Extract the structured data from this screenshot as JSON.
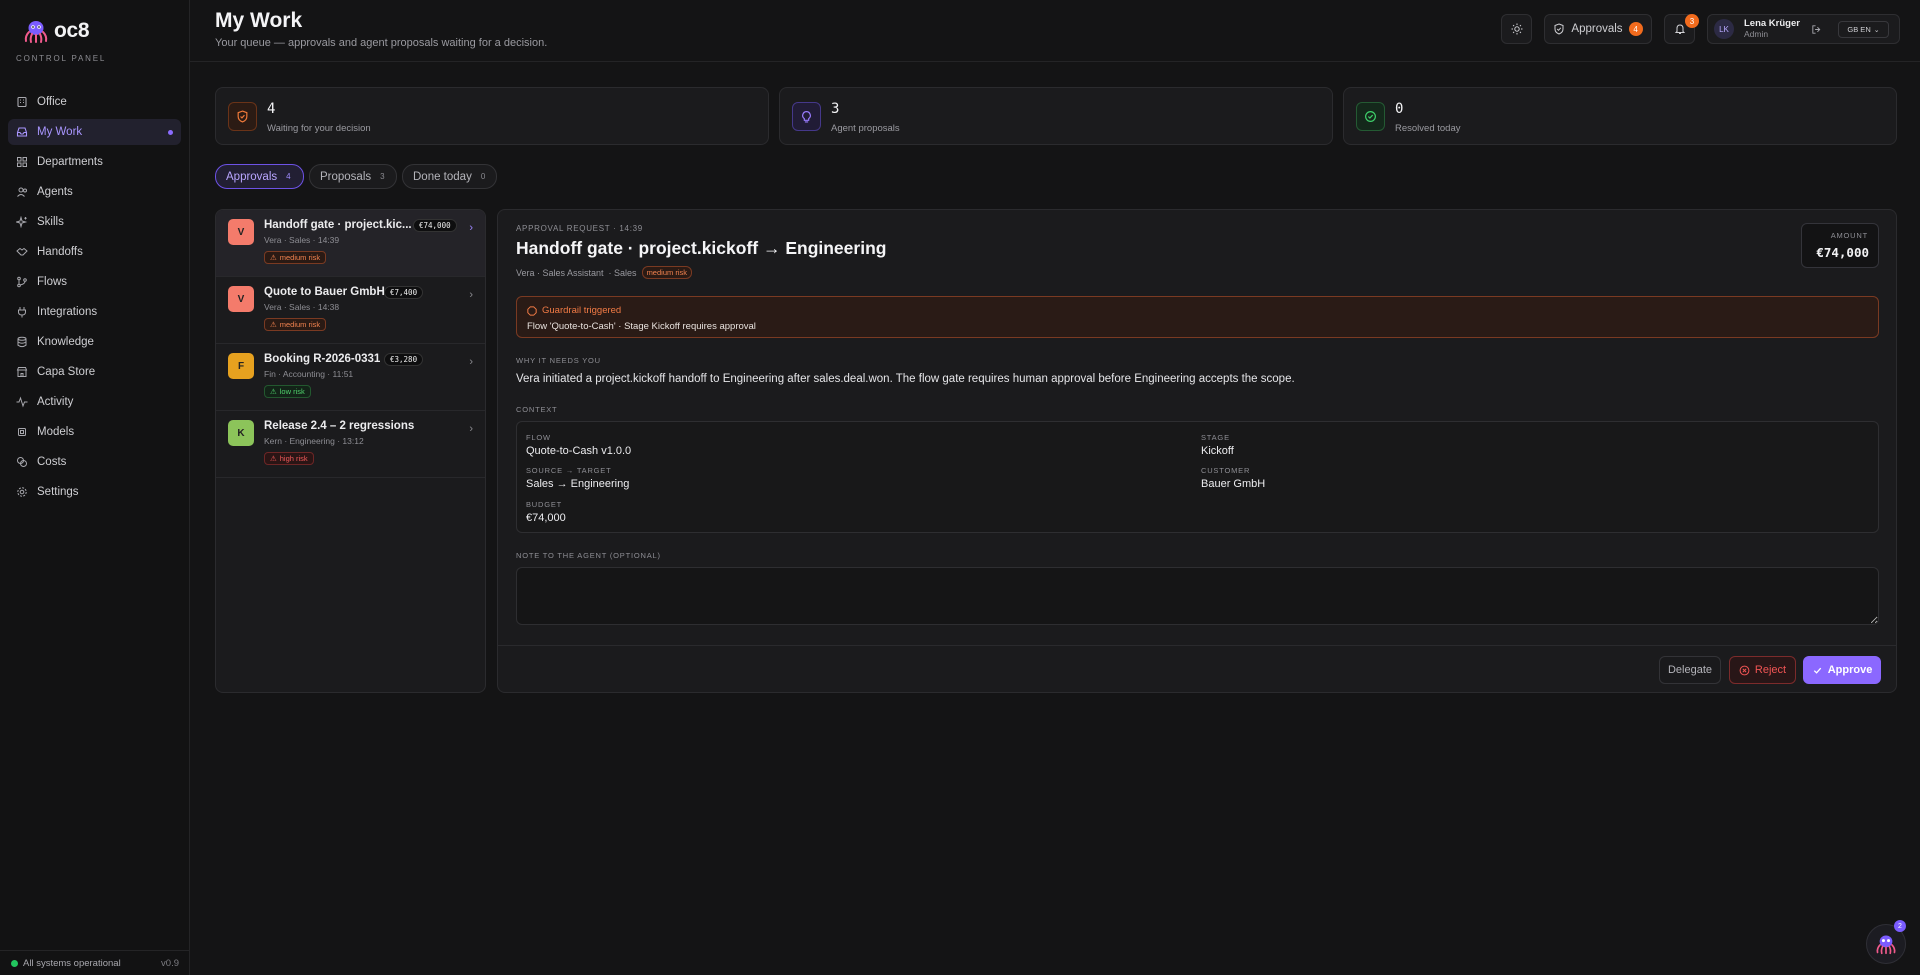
{
  "brand": {
    "name": "oc8",
    "subtitle": "CONTROL PANEL"
  },
  "nav": [
    {
      "label": "Office",
      "icon": "building-icon"
    },
    {
      "label": "My Work",
      "icon": "inbox-icon",
      "active": true
    },
    {
      "label": "Departments",
      "icon": "grid-icon"
    },
    {
      "label": "Agents",
      "icon": "users-icon"
    },
    {
      "label": "Skills",
      "icon": "sparkles-icon"
    },
    {
      "label": "Handoffs",
      "icon": "handshake-icon"
    },
    {
      "label": "Flows",
      "icon": "git-branch-icon"
    },
    {
      "label": "Integrations",
      "icon": "plug-icon"
    },
    {
      "label": "Knowledge",
      "icon": "database-icon"
    },
    {
      "label": "Capa Store",
      "icon": "store-icon"
    },
    {
      "label": "Activity",
      "icon": "activity-icon"
    },
    {
      "label": "Models",
      "icon": "cpu-icon"
    },
    {
      "label": "Costs",
      "icon": "coins-icon"
    },
    {
      "label": "Settings",
      "icon": "gear-icon"
    }
  ],
  "footer": {
    "status": "All systems operational",
    "version": "v0.9"
  },
  "header": {
    "title": "My Work",
    "subtitle": "Your queue — approvals and agent proposals waiting for a decision.",
    "approvals_label": "Approvals",
    "approvals_count": "4",
    "notifications_count": "3",
    "user_initials": "LK",
    "user_name": "Lena Krüger",
    "user_role": "Admin",
    "language": "GB EN"
  },
  "stats": [
    {
      "value": "4",
      "label": "Waiting for your decision",
      "icon": "shield-icon",
      "color": "#f07a3a"
    },
    {
      "value": "3",
      "label": "Agent proposals",
      "icon": "lightbulb-icon",
      "color": "#9a7cff"
    },
    {
      "value": "0",
      "label": "Resolved today",
      "icon": "check-circle-icon",
      "color": "#3ecf6a"
    }
  ],
  "tabs": [
    {
      "label": "Approvals",
      "count": "4",
      "active": true
    },
    {
      "label": "Proposals",
      "count": "3"
    },
    {
      "label": "Done today",
      "count": "0"
    }
  ],
  "queue": [
    {
      "initial": "V",
      "color": "#f47b6b",
      "title": "Handoff gate · project.kic...",
      "amount": "€74,000",
      "meta": "Vera · Sales · 14:39",
      "risk": "medium risk",
      "risk_level": "medium",
      "selected": true
    },
    {
      "initial": "V",
      "color": "#f47b6b",
      "title": "Quote to Bauer GmbH",
      "amount": "€7,400",
      "meta": "Vera · Sales · 14:38",
      "risk": "medium risk",
      "risk_level": "medium"
    },
    {
      "initial": "F",
      "color": "#e6a11f",
      "title": "Booking R-2026-0331",
      "amount": "€3,280",
      "meta": "Fin · Accounting · 11:51",
      "risk": "low risk",
      "risk_level": "low"
    },
    {
      "initial": "K",
      "color": "#8cc45a",
      "title": "Release 2.4 – 2 regressions",
      "amount": "",
      "meta": "Kern · Engineering · 13:12",
      "risk": "high risk",
      "risk_level": "high"
    }
  ],
  "detail": {
    "kicker": "APPROVAL REQUEST · 14:39",
    "title": "Handoff gate · project.kickoff → Engineering",
    "meta_agent": "Vera · Sales Assistant",
    "meta_dept": "· Sales",
    "risk": "medium risk",
    "amount_label": "AMOUNT",
    "amount": "€74,000",
    "guardrail_title": "Guardrail triggered",
    "guardrail_body": "Flow 'Quote-to-Cash' · Stage Kickoff requires approval",
    "why_label": "WHY IT NEEDS YOU",
    "why_text": "Vera initiated a project.kickoff handoff to Engineering after sales.deal.won. The flow gate requires human approval before Engineering accepts the scope.",
    "context_label": "CONTEXT",
    "context": {
      "flow_k": "FLOW",
      "flow_v": "Quote-to-Cash v1.0.0",
      "stage_k": "STAGE",
      "stage_v": "Kickoff",
      "src_k": "SOURCE → TARGET",
      "src_v": "Sales → Engineering",
      "cust_k": "CUSTOMER",
      "cust_v": "Bauer GmbH",
      "budget_k": "BUDGET",
      "budget_v": "€74,000"
    },
    "note_label": "NOTE TO THE AGENT (OPTIONAL)",
    "note_placeholder": "",
    "delegate": "Delegate",
    "reject": "Reject",
    "approve": "Approve"
  },
  "assistant_badge": "2"
}
